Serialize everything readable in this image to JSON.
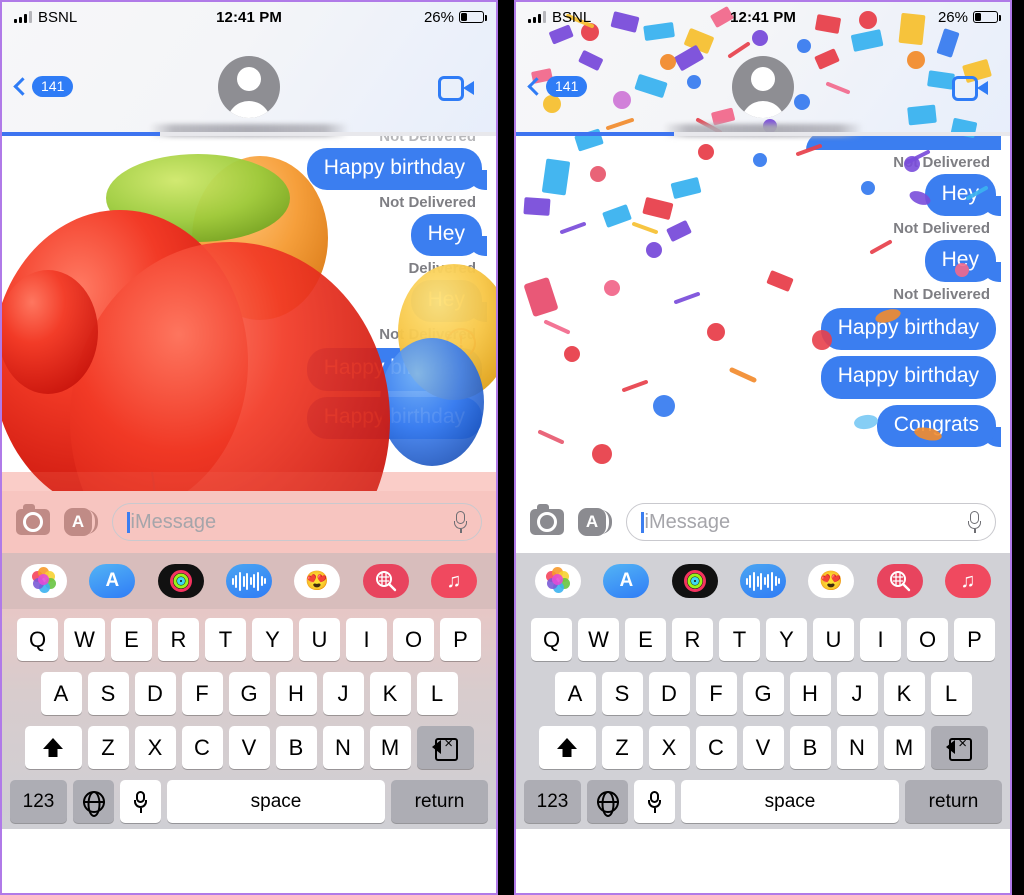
{
  "meta": {
    "panel_count": 2
  },
  "status_bar": {
    "carrier": "BSNL",
    "time": "12:41 PM",
    "battery_percent": "26%",
    "battery_level": 26,
    "signal_bars": 3,
    "signal_bars_total": 4
  },
  "nav": {
    "back_badge": "141",
    "contact_name_redacted": "",
    "facetime_icon": "video-camera-icon",
    "back_icon": "chevron-left-icon"
  },
  "progress": {
    "percent": 32
  },
  "left_panel": {
    "effect": "balloons",
    "messages": [
      {
        "type": "status",
        "text": "Not Delivered",
        "cut_off": true
      },
      {
        "type": "bubble",
        "text": "Happy birthday",
        "sender": "me",
        "tail": true
      },
      {
        "type": "status",
        "text": "Not Delivered"
      },
      {
        "type": "bubble",
        "text": "Hey",
        "sender": "me",
        "tail": true
      },
      {
        "type": "status",
        "text": "Delivered"
      },
      {
        "type": "bubble",
        "text": "Hey",
        "sender": "me",
        "tail": true,
        "failed": true
      },
      {
        "type": "status",
        "text": "Not Delivered"
      },
      {
        "type": "bubble",
        "text": "Happy birthday",
        "sender": "me"
      },
      {
        "type": "bubble",
        "text": "Happy birthday",
        "sender": "me"
      }
    ]
  },
  "right_panel": {
    "effect": "confetti",
    "messages": [
      {
        "type": "bubble_cut",
        "text": "",
        "sender": "me"
      },
      {
        "type": "status",
        "text": "Not Delivered"
      },
      {
        "type": "bubble",
        "text": "Hey",
        "sender": "me",
        "tail": true
      },
      {
        "type": "status",
        "text": "Not Delivered"
      },
      {
        "type": "bubble",
        "text": "Hey",
        "sender": "me",
        "tail": true
      },
      {
        "type": "status",
        "text": "Not Delivered"
      },
      {
        "type": "bubble",
        "text": "Happy birthday",
        "sender": "me"
      },
      {
        "type": "bubble",
        "text": "Happy birthday",
        "sender": "me"
      },
      {
        "type": "bubble",
        "text": "Congrats",
        "sender": "me",
        "tail": true
      }
    ]
  },
  "input_bar": {
    "placeholder": "iMessage",
    "value": "",
    "camera_icon": "camera-icon",
    "appstore_icon": "app-store-icon",
    "mic_icon": "microphone-icon"
  },
  "app_drawer": {
    "apps": [
      {
        "name": "photos-app-icon",
        "label": "Photos"
      },
      {
        "name": "app-store-app-icon",
        "label": "App Store"
      },
      {
        "name": "activity-app-icon",
        "label": "Activity"
      },
      {
        "name": "voice-memo-app-icon",
        "label": "Voice"
      },
      {
        "name": "memoji-app-icon",
        "label": "Memoji"
      },
      {
        "name": "images-app-icon",
        "label": "#images"
      },
      {
        "name": "music-app-icon",
        "label": "Music"
      }
    ]
  },
  "keyboard": {
    "row1": [
      "Q",
      "W",
      "E",
      "R",
      "T",
      "Y",
      "U",
      "I",
      "O",
      "P"
    ],
    "row2": [
      "A",
      "S",
      "D",
      "F",
      "G",
      "H",
      "J",
      "K",
      "L"
    ],
    "row3": [
      "Z",
      "X",
      "C",
      "V",
      "B",
      "N",
      "M"
    ],
    "shift_icon": "shift-icon",
    "backspace_icon": "backspace-icon",
    "numeric_label": "123",
    "globe_icon": "globe-icon",
    "dictation_icon": "microphone-icon",
    "space_label": "space",
    "return_label": "return"
  },
  "colors": {
    "imessage_blue": "#3b7ef0",
    "accent_blue": "#2f7cf6",
    "keyboard_bg": "#d1d1d6",
    "status_gray": "#7e7e83",
    "error_red": "#e02020"
  }
}
